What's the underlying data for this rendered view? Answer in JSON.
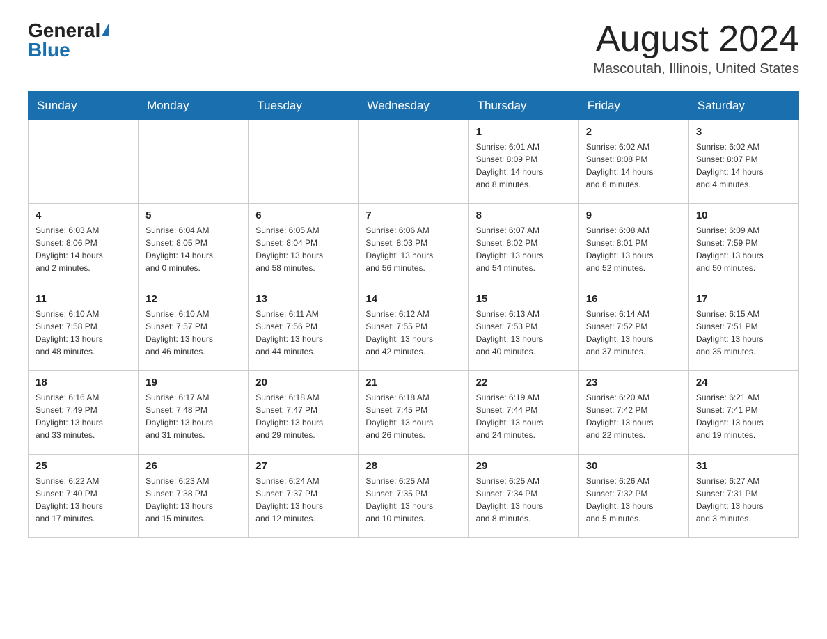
{
  "header": {
    "logo_general": "General",
    "logo_blue": "Blue",
    "month_title": "August 2024",
    "location": "Mascoutah, Illinois, United States"
  },
  "days_of_week": [
    "Sunday",
    "Monday",
    "Tuesday",
    "Wednesday",
    "Thursday",
    "Friday",
    "Saturday"
  ],
  "weeks": [
    [
      {
        "day": "",
        "info": ""
      },
      {
        "day": "",
        "info": ""
      },
      {
        "day": "",
        "info": ""
      },
      {
        "day": "",
        "info": ""
      },
      {
        "day": "1",
        "info": "Sunrise: 6:01 AM\nSunset: 8:09 PM\nDaylight: 14 hours\nand 8 minutes."
      },
      {
        "day": "2",
        "info": "Sunrise: 6:02 AM\nSunset: 8:08 PM\nDaylight: 14 hours\nand 6 minutes."
      },
      {
        "day": "3",
        "info": "Sunrise: 6:02 AM\nSunset: 8:07 PM\nDaylight: 14 hours\nand 4 minutes."
      }
    ],
    [
      {
        "day": "4",
        "info": "Sunrise: 6:03 AM\nSunset: 8:06 PM\nDaylight: 14 hours\nand 2 minutes."
      },
      {
        "day": "5",
        "info": "Sunrise: 6:04 AM\nSunset: 8:05 PM\nDaylight: 14 hours\nand 0 minutes."
      },
      {
        "day": "6",
        "info": "Sunrise: 6:05 AM\nSunset: 8:04 PM\nDaylight: 13 hours\nand 58 minutes."
      },
      {
        "day": "7",
        "info": "Sunrise: 6:06 AM\nSunset: 8:03 PM\nDaylight: 13 hours\nand 56 minutes."
      },
      {
        "day": "8",
        "info": "Sunrise: 6:07 AM\nSunset: 8:02 PM\nDaylight: 13 hours\nand 54 minutes."
      },
      {
        "day": "9",
        "info": "Sunrise: 6:08 AM\nSunset: 8:01 PM\nDaylight: 13 hours\nand 52 minutes."
      },
      {
        "day": "10",
        "info": "Sunrise: 6:09 AM\nSunset: 7:59 PM\nDaylight: 13 hours\nand 50 minutes."
      }
    ],
    [
      {
        "day": "11",
        "info": "Sunrise: 6:10 AM\nSunset: 7:58 PM\nDaylight: 13 hours\nand 48 minutes."
      },
      {
        "day": "12",
        "info": "Sunrise: 6:10 AM\nSunset: 7:57 PM\nDaylight: 13 hours\nand 46 minutes."
      },
      {
        "day": "13",
        "info": "Sunrise: 6:11 AM\nSunset: 7:56 PM\nDaylight: 13 hours\nand 44 minutes."
      },
      {
        "day": "14",
        "info": "Sunrise: 6:12 AM\nSunset: 7:55 PM\nDaylight: 13 hours\nand 42 minutes."
      },
      {
        "day": "15",
        "info": "Sunrise: 6:13 AM\nSunset: 7:53 PM\nDaylight: 13 hours\nand 40 minutes."
      },
      {
        "day": "16",
        "info": "Sunrise: 6:14 AM\nSunset: 7:52 PM\nDaylight: 13 hours\nand 37 minutes."
      },
      {
        "day": "17",
        "info": "Sunrise: 6:15 AM\nSunset: 7:51 PM\nDaylight: 13 hours\nand 35 minutes."
      }
    ],
    [
      {
        "day": "18",
        "info": "Sunrise: 6:16 AM\nSunset: 7:49 PM\nDaylight: 13 hours\nand 33 minutes."
      },
      {
        "day": "19",
        "info": "Sunrise: 6:17 AM\nSunset: 7:48 PM\nDaylight: 13 hours\nand 31 minutes."
      },
      {
        "day": "20",
        "info": "Sunrise: 6:18 AM\nSunset: 7:47 PM\nDaylight: 13 hours\nand 29 minutes."
      },
      {
        "day": "21",
        "info": "Sunrise: 6:18 AM\nSunset: 7:45 PM\nDaylight: 13 hours\nand 26 minutes."
      },
      {
        "day": "22",
        "info": "Sunrise: 6:19 AM\nSunset: 7:44 PM\nDaylight: 13 hours\nand 24 minutes."
      },
      {
        "day": "23",
        "info": "Sunrise: 6:20 AM\nSunset: 7:42 PM\nDaylight: 13 hours\nand 22 minutes."
      },
      {
        "day": "24",
        "info": "Sunrise: 6:21 AM\nSunset: 7:41 PM\nDaylight: 13 hours\nand 19 minutes."
      }
    ],
    [
      {
        "day": "25",
        "info": "Sunrise: 6:22 AM\nSunset: 7:40 PM\nDaylight: 13 hours\nand 17 minutes."
      },
      {
        "day": "26",
        "info": "Sunrise: 6:23 AM\nSunset: 7:38 PM\nDaylight: 13 hours\nand 15 minutes."
      },
      {
        "day": "27",
        "info": "Sunrise: 6:24 AM\nSunset: 7:37 PM\nDaylight: 13 hours\nand 12 minutes."
      },
      {
        "day": "28",
        "info": "Sunrise: 6:25 AM\nSunset: 7:35 PM\nDaylight: 13 hours\nand 10 minutes."
      },
      {
        "day": "29",
        "info": "Sunrise: 6:25 AM\nSunset: 7:34 PM\nDaylight: 13 hours\nand 8 minutes."
      },
      {
        "day": "30",
        "info": "Sunrise: 6:26 AM\nSunset: 7:32 PM\nDaylight: 13 hours\nand 5 minutes."
      },
      {
        "day": "31",
        "info": "Sunrise: 6:27 AM\nSunset: 7:31 PM\nDaylight: 13 hours\nand 3 minutes."
      }
    ]
  ]
}
